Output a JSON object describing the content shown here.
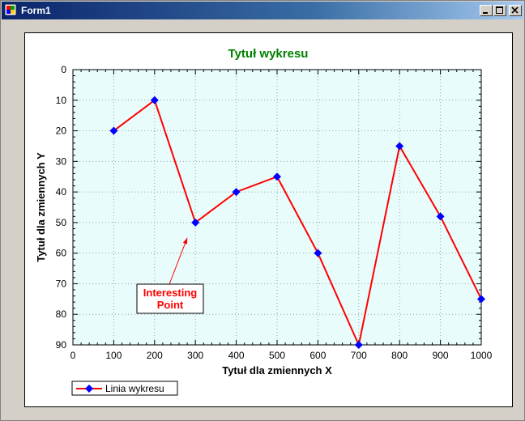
{
  "window": {
    "title": "Form1"
  },
  "caption_buttons": {
    "minimize": "minimize",
    "maximize": "maximize",
    "close": "close"
  },
  "colors": {
    "title_green": "#008000",
    "plot_bg": "#e8fcfc",
    "line": "#ff0000",
    "marker": "#0000ff",
    "annotation": "#ff0000"
  },
  "chart_data": {
    "type": "line",
    "title": "Tytuł wykresu",
    "xlabel": "Tytuł dla zmiennych X",
    "ylabel": "Tytuł dla zmiennych Y",
    "xlim": [
      0,
      1000
    ],
    "ylim": [
      0,
      90
    ],
    "y_inverted": true,
    "grid": true,
    "legend_position": "bottom-left",
    "x_ticks": [
      0,
      100,
      200,
      300,
      400,
      500,
      600,
      700,
      800,
      900,
      1000
    ],
    "y_ticks": [
      0,
      10,
      20,
      30,
      40,
      50,
      60,
      70,
      80,
      90
    ],
    "series": [
      {
        "name": "Linia wykresu",
        "x": [
          100,
          200,
          300,
          400,
          500,
          600,
          700,
          800,
          900,
          1000
        ],
        "y": [
          20,
          10,
          50,
          40,
          35,
          60,
          90,
          25,
          48,
          75
        ]
      }
    ],
    "annotations": [
      {
        "text_lines": [
          "Interesting",
          "Point"
        ],
        "target_x": 280,
        "target_y": 55
      }
    ]
  }
}
